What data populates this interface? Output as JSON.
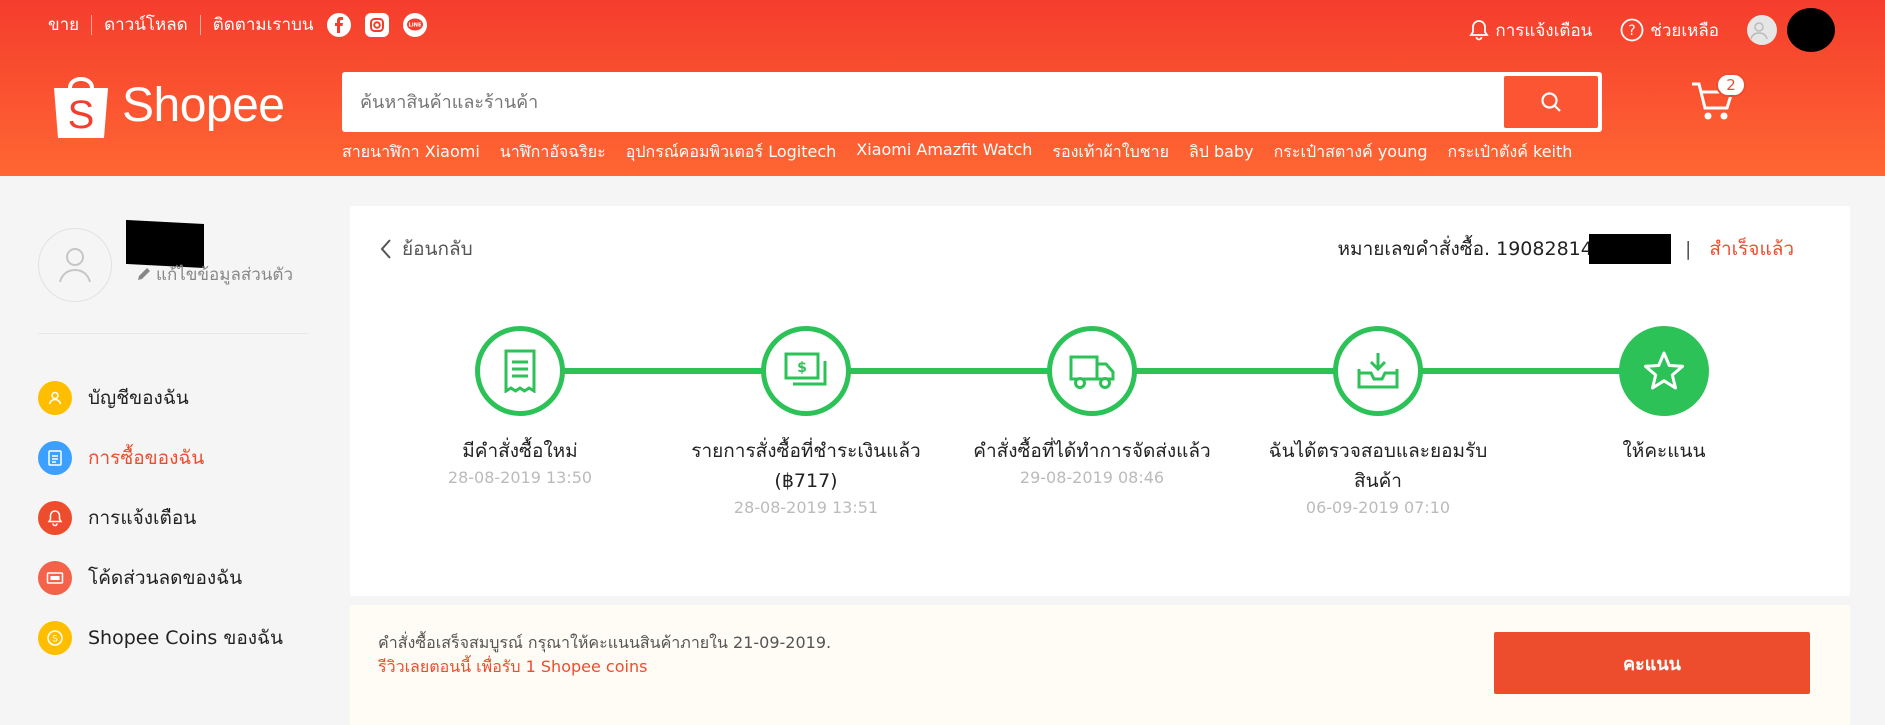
{
  "colors": {
    "brand": "#ee4d2d",
    "success": "#2dc258"
  },
  "topbar": {
    "sell": "ขาย",
    "download": "ดาวน์โหลด",
    "follow": "ติดตามเราบน",
    "social_icons": [
      "facebook-icon",
      "instagram-icon",
      "line-icon"
    ],
    "notifications": "การแจ้งเตือน",
    "help": "ช่วยเหลือ"
  },
  "header": {
    "logo_text": "Shopee",
    "search_placeholder": "ค้นหาสินค้าและร้านค้า",
    "suggestions": [
      "สายนาฬิกา Xiaomi",
      "นาฬิกาอัจฉริยะ",
      "อุปกรณ์คอมพิวเตอร์ Logitech",
      "Xiaomi Amazfit Watch",
      "รองเท้าผ้าใบชาย",
      "ลิป baby",
      "กระเป๋าสตางค์ young",
      "กระเป๋าตังค์ keith"
    ],
    "cart_count": "2"
  },
  "sidebar": {
    "edit_profile": "แก้ไขข้อมูลส่วนตัว",
    "items": [
      {
        "label": "บัญชีของฉัน",
        "icon": "user-icon",
        "color": "#ffbf00"
      },
      {
        "label": "การซื้อของฉัน",
        "icon": "clipboard-icon",
        "color": "#3ba0ff"
      },
      {
        "label": "การแจ้งเตือน",
        "icon": "bell-icon",
        "color": "#ee4d2d"
      },
      {
        "label": "โค้ดส่วนลดของฉัน",
        "icon": "voucher-icon",
        "color": "#f4624a"
      },
      {
        "label": "Shopee Coins ของฉัน",
        "icon": "coin-icon",
        "color": "#ffbf00"
      }
    ]
  },
  "order": {
    "back": "ย้อนกลับ",
    "order_no_label": "หมายเลขคำสั่งซื้อ. 190828145",
    "separator": "|",
    "status": "สำเร็จแล้ว",
    "steps": [
      {
        "label": "มีคำสั่งซื้อใหม่",
        "date": "28-08-2019 13:50",
        "icon": "receipt-icon"
      },
      {
        "label": "รายการสั่งซื้อที่ชำระเงินแล้ว (฿717)",
        "date": "28-08-2019 13:51",
        "icon": "money-icon"
      },
      {
        "label": "คำสั่งซื้อที่ได้ทำการจัดส่งแล้ว",
        "date": "29-08-2019 08:46",
        "icon": "truck-icon"
      },
      {
        "label": "ฉันได้ตรวจสอบและยอมรับสินค้า",
        "date": "06-09-2019 07:10",
        "icon": "inbox-download-icon"
      },
      {
        "label": "ให้คะแนน",
        "date": "",
        "icon": "star-icon"
      }
    ]
  },
  "notice": {
    "line1": "คำสั่งซื้อเสร็จสมบูรณ์ กรุณาให้คะแนนสินค้าภายใน 21-09-2019.",
    "line2": "รีวิวเลยตอนนี้ เพื่อรับ 1 Shopee coins",
    "button": "คะแนน"
  }
}
